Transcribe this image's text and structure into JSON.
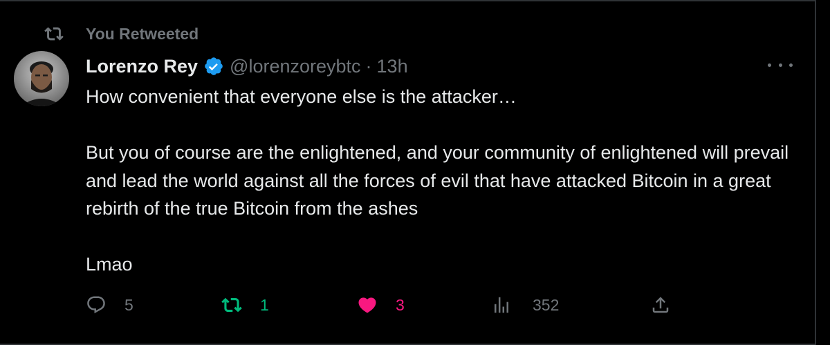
{
  "retweet_notice": {
    "label": "You Retweeted"
  },
  "tweet": {
    "author_name": "Lorenzo Rey",
    "handle": "@lorenzoreybtc",
    "separator": "·",
    "time": "13h",
    "verified": true,
    "text": "How convenient that everyone else is the attacker…\n\nBut you of course are the enlightened, and your community of enlightened will prevail and lead the world against all the forces of evil that have attacked Bitcoin in a great rebirth of the true Bitcoin from the ashes\n\nLmao"
  },
  "actions": {
    "replies": "5",
    "retweets": "1",
    "likes": "3",
    "views": "352"
  },
  "colors": {
    "background": "#000000",
    "text": "#e7e9ea",
    "muted": "#71767b",
    "retweet_active": "#00ba7c",
    "like_active": "#f91880",
    "verified": "#1d9bf0"
  },
  "icons": {
    "retweet_notice": "retweet-icon",
    "verified": "verified-badge-icon",
    "more": "more-horizontal-icon",
    "reply": "reply-icon",
    "retweet": "retweet-icon",
    "like": "heart-icon",
    "views": "analytics-icon",
    "share": "share-icon"
  }
}
